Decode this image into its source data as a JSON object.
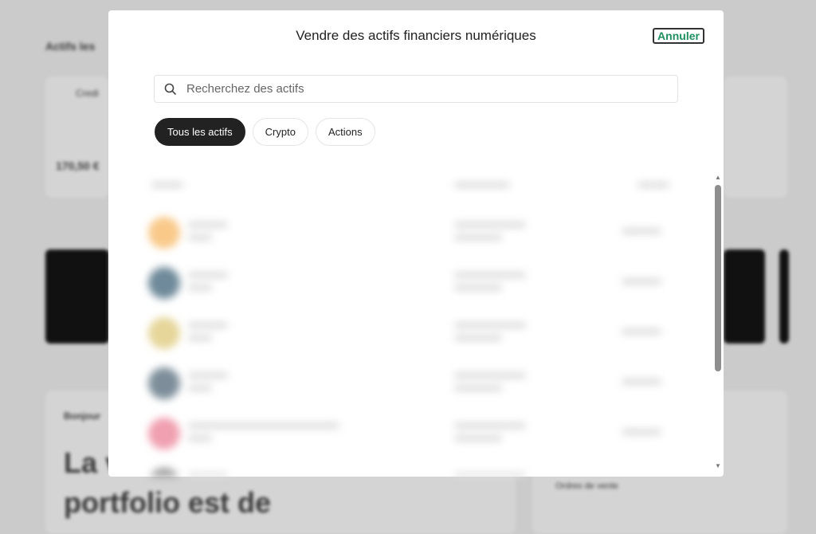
{
  "background": {
    "section_title": "Actifs les",
    "card_label": "Credi",
    "card_value": "170,50 €",
    "greeting": "Bonjour",
    "headline_1": "La v",
    "headline_2": "portfolio est de",
    "sell_orders": "Ordres de vente"
  },
  "modal": {
    "title": "Vendre des actifs financiers numériques",
    "cancel_label": "Annuler",
    "cancel_color": "#1f8f5f",
    "search": {
      "placeholder": "Recherchez des actifs",
      "value": "",
      "icon": "search-icon"
    },
    "filters": [
      {
        "label": "Tous les actifs",
        "active": true
      },
      {
        "label": "Crypto",
        "active": false
      },
      {
        "label": "Actions",
        "active": false
      }
    ],
    "asset_colors": [
      "#f9c98a",
      "#6f8a9a",
      "#e6d69a",
      "#7d8e9a",
      "#f0a0b0",
      "#9a9a9a"
    ]
  }
}
